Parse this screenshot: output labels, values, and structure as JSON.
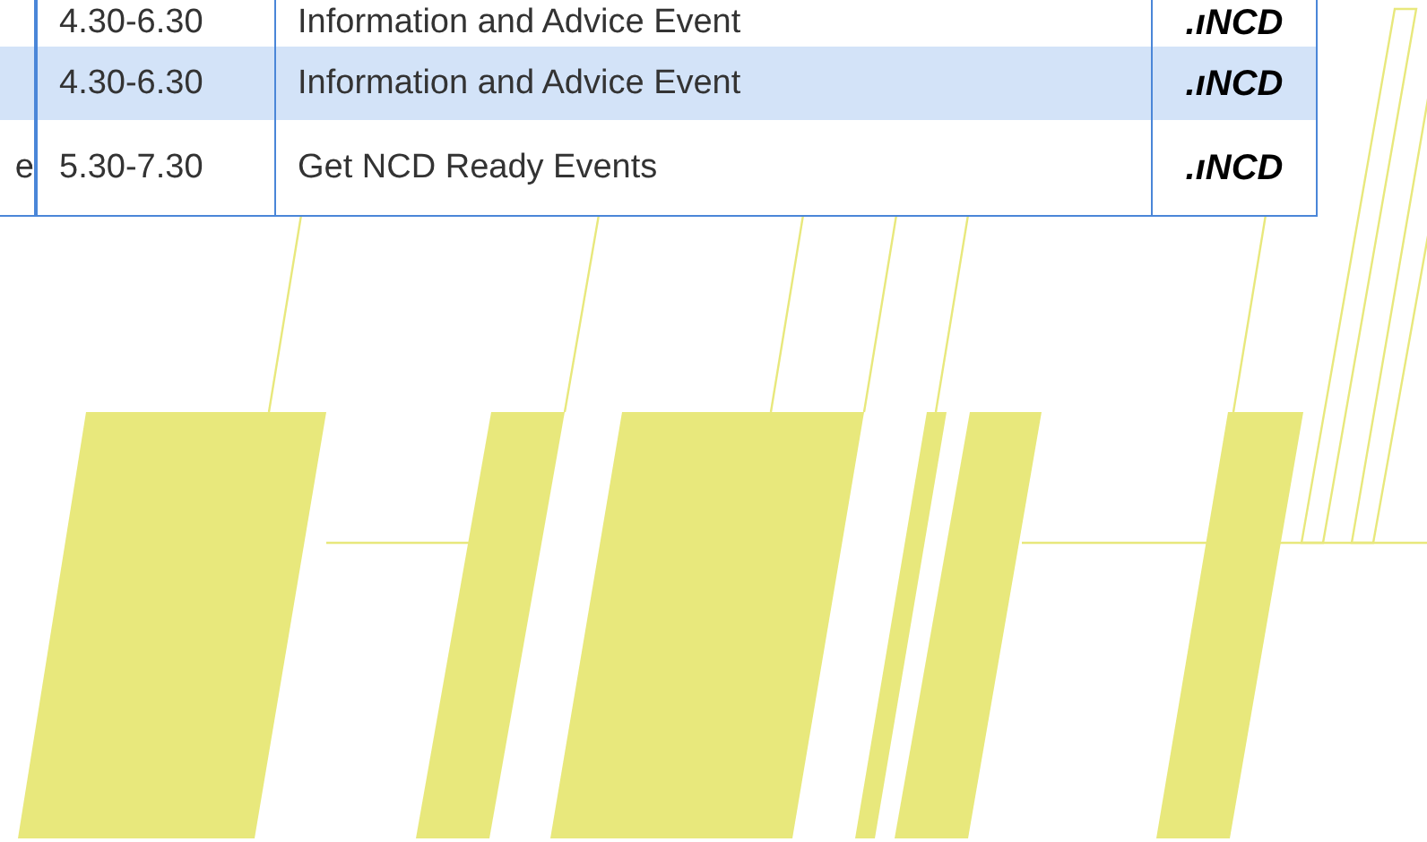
{
  "table": {
    "rows": [
      {
        "column_1": "",
        "time": "4.30-6.30",
        "event": "Information and Advice Event",
        "logo": ".ıNCD",
        "selected": false
      },
      {
        "column_1": "",
        "time": "4.30-6.30",
        "event": "Information and Advice Event",
        "logo": ".ıNCD",
        "selected": true
      },
      {
        "column_1": "e",
        "time": "5.30-7.30",
        "event": "Get NCD Ready Events",
        "logo": ".ıNCD",
        "selected": false
      }
    ]
  }
}
